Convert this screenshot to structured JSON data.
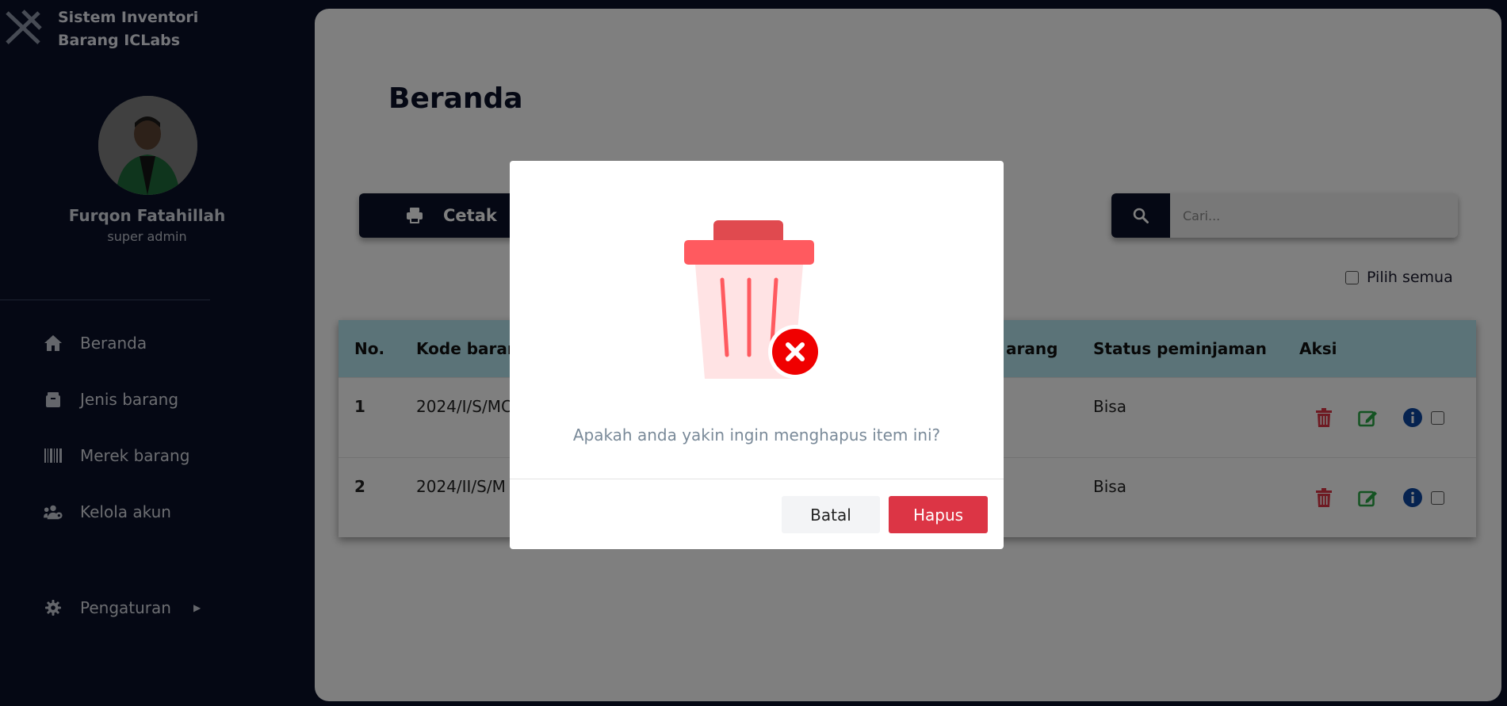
{
  "app": {
    "title": "Sistem Inventori Barang ICLabs"
  },
  "user": {
    "name": "Furqon Fatahillah",
    "role": "super admin"
  },
  "sidebar": {
    "items": [
      {
        "label": "Beranda",
        "icon": "home-icon"
      },
      {
        "label": "Jenis barang",
        "icon": "box-icon"
      },
      {
        "label": "Merek barang",
        "icon": "barcode-icon"
      },
      {
        "label": "Kelola akun",
        "icon": "users-icon"
      },
      {
        "label": "Pengaturan",
        "icon": "gear-icon"
      }
    ]
  },
  "main": {
    "title": "Beranda",
    "print_label": "Cetak",
    "search_placeholder": "Cari...",
    "select_all_label": "Pilih semua"
  },
  "table": {
    "headers": [
      "No.",
      "Kode barang",
      "arang",
      "Status peminjaman",
      "Aksi"
    ],
    "rows": [
      {
        "no": "1",
        "kode": "2024/I/S/MC",
        "status": "Bisa"
      },
      {
        "no": "2",
        "kode": "2024/II/S/M",
        "status": "Bisa"
      }
    ]
  },
  "modal": {
    "message": "Apakah anda yakin ingin menghapus item ini?",
    "cancel_label": "Batal",
    "confirm_label": "Hapus"
  },
  "colors": {
    "navy": "#0a1128",
    "header_row": "#b7e7f0",
    "danger": "#dc3545",
    "edit_green": "#28a745",
    "info_blue": "#0d47a1"
  }
}
